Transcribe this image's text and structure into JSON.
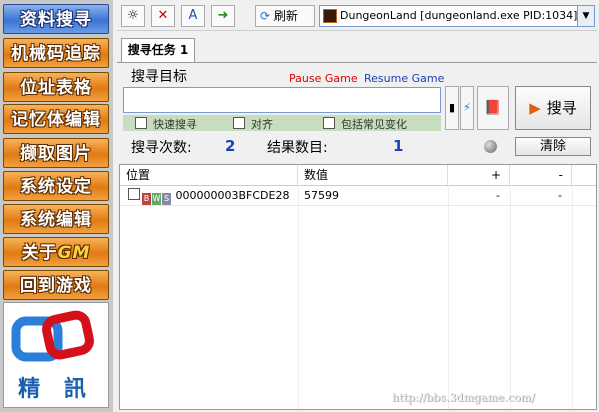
{
  "sidebar": {
    "items": [
      {
        "label": "资料搜寻",
        "style": "blue"
      },
      {
        "label": "机械码追踪",
        "style": "orange"
      },
      {
        "label": "位址表格",
        "style": "orange"
      },
      {
        "label": "记忆体编辑",
        "style": "orange"
      },
      {
        "label": "撷取图片",
        "style": "orange"
      },
      {
        "label": "系统设定",
        "style": "orange"
      },
      {
        "label": "系统编辑",
        "style": "orange"
      },
      {
        "label": "关于",
        "suffix": "GM",
        "style": "orange"
      },
      {
        "label": "回到游戏",
        "style": "orange"
      }
    ],
    "logo_text": "精 訊"
  },
  "toolbar": {
    "refresh_label": "刷新",
    "process_label": "DungeonLand [dungeonland.exe PID:1034]"
  },
  "tabs": [
    {
      "label": "搜寻任务 1"
    }
  ],
  "search": {
    "target_label": "搜寻目标",
    "pause_label": "Pause Game",
    "resume_label": "Resume Game",
    "input_value": "",
    "options": [
      {
        "label": "快速搜寻",
        "checked": false
      },
      {
        "label": "对齐",
        "checked": false
      },
      {
        "label": "包括常见变化",
        "checked": false
      }
    ],
    "search_button_label": "搜寻"
  },
  "stats": {
    "count_label": "搜寻次数:",
    "count_value": "2",
    "results_label": "结果数目:",
    "results_value": "1",
    "clear_label": "清除"
  },
  "table": {
    "headers": [
      "位置",
      "数值",
      "+",
      "-"
    ],
    "rows": [
      {
        "address": "000000003BFCDE28",
        "value": "57599",
        "plus": "-",
        "minus": "-"
      }
    ]
  },
  "watermark": "http://bbs.3dmgame.com/",
  "colors": {
    "accent_blue": "#1a40c0",
    "pause_red": "#dd0000",
    "option_bg": "#c8dcc0"
  }
}
